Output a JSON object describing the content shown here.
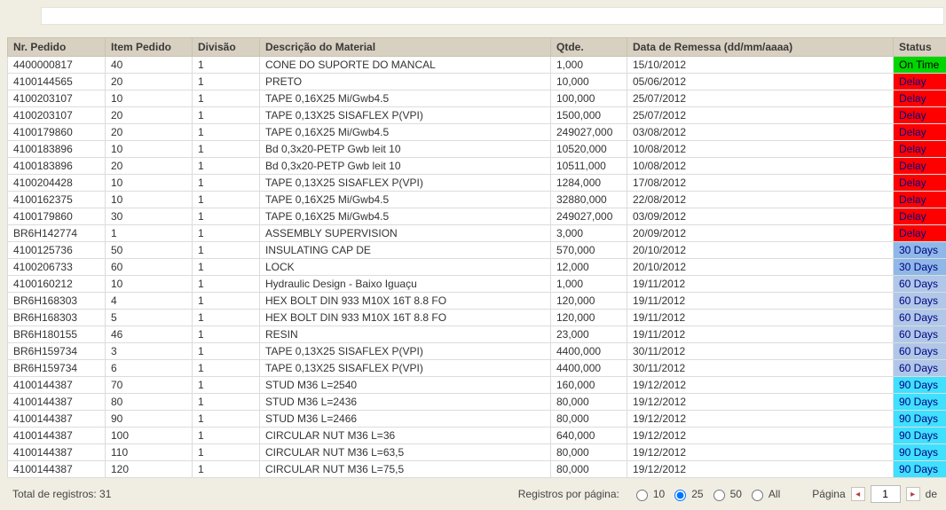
{
  "columns": {
    "nr": "Nr. Pedido",
    "item": "Item Pedido",
    "div": "Divisão",
    "desc": "Descrição do Material",
    "qtde": "Qtde.",
    "data": "Data de Remessa (dd/mm/aaaa)",
    "status": "Status"
  },
  "status_styles": {
    "On Time": {
      "bg": "#00d600",
      "fg": "#000000"
    },
    "Delay": {
      "bg": "#ff0000",
      "fg": "#000080"
    },
    "30 Days": {
      "bg": "#8fb8e8",
      "fg": "#000080"
    },
    "60 Days": {
      "bg": "#b0c7e8",
      "fg": "#000080"
    },
    "90 Days": {
      "bg": "#40e0ff",
      "fg": "#000080"
    }
  },
  "rows": [
    {
      "nr": "4400000817",
      "item": "40",
      "div": "1",
      "desc": "CONE DO SUPORTE DO MANCAL",
      "qtde": "1,000",
      "data": "15/10/2012",
      "status": "On Time"
    },
    {
      "nr": "4100144565",
      "item": "20",
      "div": "1",
      "desc": "PRETO",
      "qtde": "10,000",
      "data": "05/06/2012",
      "status": "Delay"
    },
    {
      "nr": "4100203107",
      "item": "10",
      "div": "1",
      "desc": "TAPE 0,16X25 Mi/Gwb4.5",
      "qtde": "100,000",
      "data": "25/07/2012",
      "status": "Delay"
    },
    {
      "nr": "4100203107",
      "item": "20",
      "div": "1",
      "desc": "TAPE 0,13X25 SISAFLEX P(VPI)",
      "qtde": "1500,000",
      "data": "25/07/2012",
      "status": "Delay"
    },
    {
      "nr": "4100179860",
      "item": "20",
      "div": "1",
      "desc": "TAPE 0,16X25 Mi/Gwb4.5",
      "qtde": "249027,000",
      "data": "03/08/2012",
      "status": "Delay"
    },
    {
      "nr": "4100183896",
      "item": "10",
      "div": "1",
      "desc": "Bd 0,3x20-PETP Gwb leit 10",
      "qtde": "10520,000",
      "data": "10/08/2012",
      "status": "Delay"
    },
    {
      "nr": "4100183896",
      "item": "20",
      "div": "1",
      "desc": "Bd 0,3x20-PETP Gwb leit 10",
      "qtde": "10511,000",
      "data": "10/08/2012",
      "status": "Delay"
    },
    {
      "nr": "4100204428",
      "item": "10",
      "div": "1",
      "desc": "TAPE 0,13X25 SISAFLEX P(VPI)",
      "qtde": "1284,000",
      "data": "17/08/2012",
      "status": "Delay"
    },
    {
      "nr": "4100162375",
      "item": "10",
      "div": "1",
      "desc": "TAPE 0,16X25 Mi/Gwb4.5",
      "qtde": "32880,000",
      "data": "22/08/2012",
      "status": "Delay"
    },
    {
      "nr": "4100179860",
      "item": "30",
      "div": "1",
      "desc": "TAPE 0,16X25 Mi/Gwb4.5",
      "qtde": "249027,000",
      "data": "03/09/2012",
      "status": "Delay"
    },
    {
      "nr": "BR6H142774",
      "item": "1",
      "div": "1",
      "desc": "ASSEMBLY SUPERVISION",
      "qtde": "3,000",
      "data": "20/09/2012",
      "status": "Delay"
    },
    {
      "nr": "4100125736",
      "item": "50",
      "div": "1",
      "desc": "INSULATING CAP DE",
      "qtde": "570,000",
      "data": "20/10/2012",
      "status": "30 Days"
    },
    {
      "nr": "4100206733",
      "item": "60",
      "div": "1",
      "desc": "LOCK",
      "qtde": "12,000",
      "data": "20/10/2012",
      "status": "30 Days"
    },
    {
      "nr": "4100160212",
      "item": "10",
      "div": "1",
      "desc": "Hydraulic Design - Baixo Iguaçu",
      "qtde": "1,000",
      "data": "19/11/2012",
      "status": "60 Days"
    },
    {
      "nr": "BR6H168303",
      "item": "4",
      "div": "1",
      "desc": "HEX BOLT DIN 933 M10X 16T 8.8 FO",
      "qtde": "120,000",
      "data": "19/11/2012",
      "status": "60 Days"
    },
    {
      "nr": "BR6H168303",
      "item": "5",
      "div": "1",
      "desc": "HEX BOLT DIN 933 M10X 16T 8.8 FO",
      "qtde": "120,000",
      "data": "19/11/2012",
      "status": "60 Days"
    },
    {
      "nr": "BR6H180155",
      "item": "46",
      "div": "1",
      "desc": "RESIN",
      "qtde": "23,000",
      "data": "19/11/2012",
      "status": "60 Days"
    },
    {
      "nr": "BR6H159734",
      "item": "3",
      "div": "1",
      "desc": "TAPE 0,13X25 SISAFLEX P(VPI)",
      "qtde": "4400,000",
      "data": "30/11/2012",
      "status": "60 Days"
    },
    {
      "nr": "BR6H159734",
      "item": "6",
      "div": "1",
      "desc": "TAPE 0,13X25 SISAFLEX P(VPI)",
      "qtde": "4400,000",
      "data": "30/11/2012",
      "status": "60 Days"
    },
    {
      "nr": "4100144387",
      "item": "70",
      "div": "1",
      "desc": "STUD M36 L=2540",
      "qtde": "160,000",
      "data": "19/12/2012",
      "status": "90 Days"
    },
    {
      "nr": "4100144387",
      "item": "80",
      "div": "1",
      "desc": "STUD M36 L=2436",
      "qtde": "80,000",
      "data": "19/12/2012",
      "status": "90 Days"
    },
    {
      "nr": "4100144387",
      "item": "90",
      "div": "1",
      "desc": "STUD M36 L=2466",
      "qtde": "80,000",
      "data": "19/12/2012",
      "status": "90 Days"
    },
    {
      "nr": "4100144387",
      "item": "100",
      "div": "1",
      "desc": "CIRCULAR NUT M36 L=36",
      "qtde": "640,000",
      "data": "19/12/2012",
      "status": "90 Days"
    },
    {
      "nr": "4100144387",
      "item": "110",
      "div": "1",
      "desc": "CIRCULAR NUT M36 L=63,5",
      "qtde": "80,000",
      "data": "19/12/2012",
      "status": "90 Days"
    },
    {
      "nr": "4100144387",
      "item": "120",
      "div": "1",
      "desc": "CIRCULAR NUT M36 L=75,5",
      "qtde": "80,000",
      "data": "19/12/2012",
      "status": "90 Days"
    }
  ],
  "footer": {
    "total_label": "Total de registros: 31",
    "per_page_label": "Registros por página:",
    "options": [
      "10",
      "25",
      "50",
      "All"
    ],
    "selected_option": "25",
    "page_label": "Página",
    "page_value": "1",
    "page_suffix": "de"
  }
}
